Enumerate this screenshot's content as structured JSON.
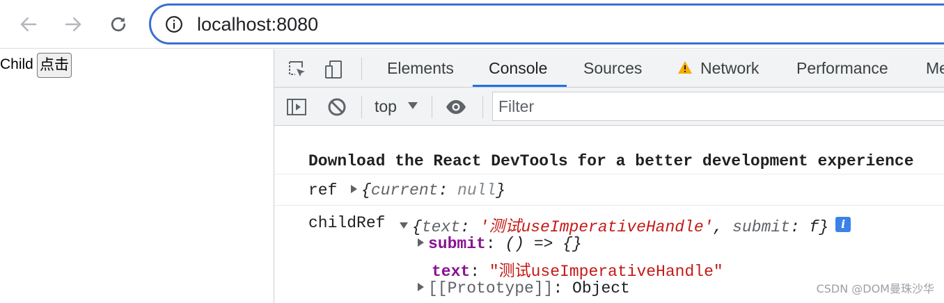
{
  "browser": {
    "url": "localhost:8080",
    "icons": {
      "back": "arrow-left-icon",
      "forward": "arrow-right-icon",
      "reload": "reload-icon",
      "site_info": "info-icon"
    }
  },
  "page": {
    "text": "Child",
    "button_label": "点击"
  },
  "devtools": {
    "tabs": [
      {
        "label": "Elements",
        "active": false
      },
      {
        "label": "Console",
        "active": true
      },
      {
        "label": "Sources",
        "active": false
      },
      {
        "label": "Network",
        "active": false,
        "warning": true
      },
      {
        "label": "Performance",
        "active": false
      },
      {
        "label": "Me",
        "active": false
      }
    ],
    "context_label": "top",
    "filter_placeholder": "Filter",
    "accent_color": "#1a73e8"
  },
  "console": {
    "banner": "Download the React DevTools for a better development experience",
    "ref_line": {
      "label": "ref",
      "open": "{",
      "key": "current",
      "colon": ": ",
      "value": "null",
      "close": "}"
    },
    "childref_line": {
      "label": "childRef",
      "preview": {
        "open": "{",
        "key1": "text",
        "colon": ": ",
        "value1": "'测试useImperativeHandle'",
        "comma": ", ",
        "key2": "submit",
        "value2": "f",
        "close": "}",
        "badge": "i"
      },
      "props": [
        {
          "key": "submit",
          "colon": ": ",
          "value": "() => {}"
        },
        {
          "key": "text",
          "colon": ": ",
          "value": "\"测试useImperativeHandle\""
        },
        {
          "key": "[[Prototype]]",
          "colon": ": ",
          "value": "Object"
        }
      ]
    }
  },
  "watermark": "CSDN @DOM曼珠沙华"
}
